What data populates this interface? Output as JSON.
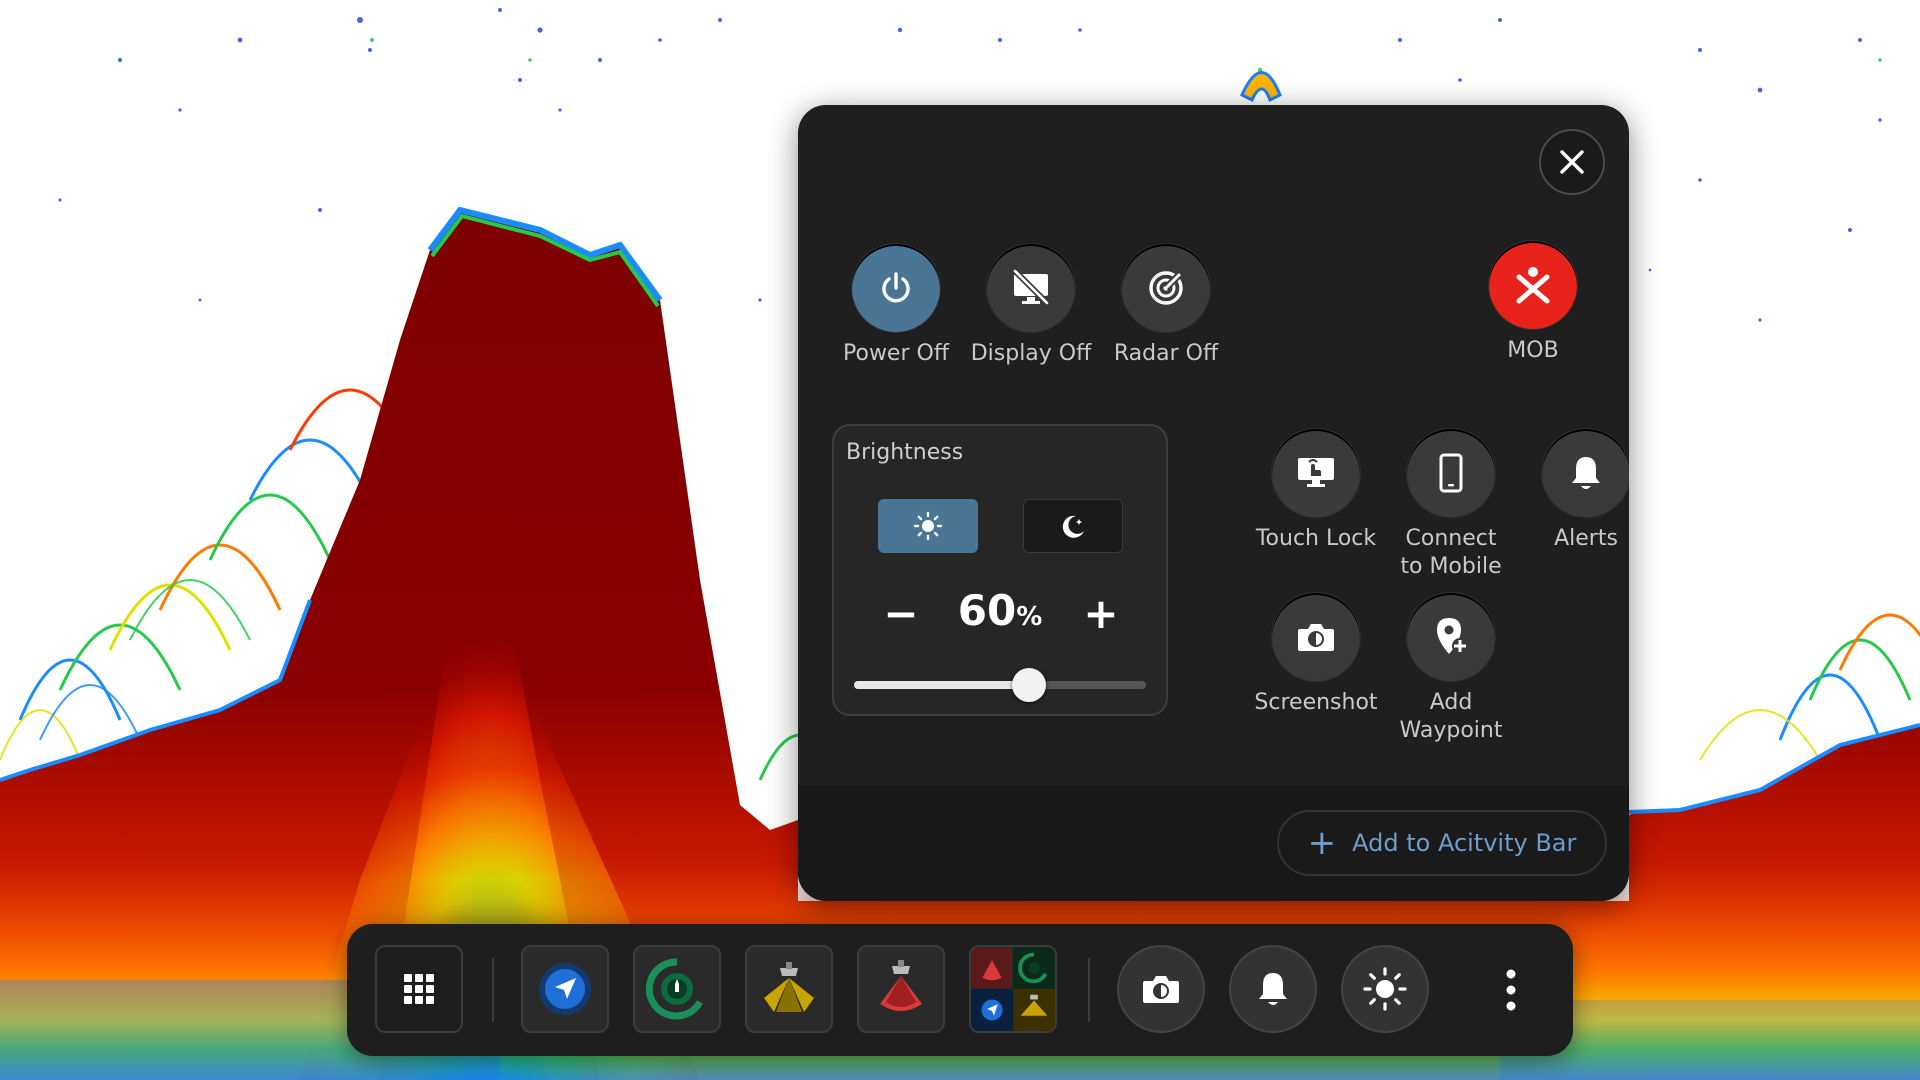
{
  "colors": {
    "accent_blue": "#4a7595",
    "mob_red": "#e7231c",
    "panel_bg": "#1f1f1f",
    "link_blue": "#6e9ccc",
    "sonar_deep_red": "#7a0000"
  },
  "panel": {
    "close_icon": "close-icon",
    "actions": [
      {
        "label": "Power Off",
        "icon": "power-icon"
      },
      {
        "label": "Display Off",
        "icon": "display-off-icon"
      },
      {
        "label": "Radar Off",
        "icon": "radar-off-icon"
      },
      {
        "label": "MOB",
        "icon": "man-overboard-icon"
      }
    ],
    "brightness": {
      "title": "Brightness",
      "day_icon": "sun-icon",
      "night_icon": "moon-icon",
      "minus": "−",
      "plus": "+",
      "value": "60",
      "unit": "%",
      "level": 0.6
    },
    "grid_actions": [
      {
        "label": "Touch Lock",
        "icon": "touch-lock-icon"
      },
      {
        "label": "Connect to Mobile",
        "label_line1": "Connect",
        "label_line2": "to Mobile",
        "icon": "mobile-icon"
      },
      {
        "label": "Alerts",
        "icon": "bell-icon"
      },
      {
        "label": "Screenshot",
        "icon": "camera-icon"
      },
      {
        "label": "Add Waypoint",
        "label_line1": "Add",
        "label_line2": "Waypoint",
        "icon": "add-waypoint-icon"
      }
    ],
    "add_activity": "Add to Acitvity Bar"
  },
  "activity_bar": {
    "items": [
      {
        "icon": "apps-grid-icon"
      },
      {
        "icon": "navigation-chart-icon"
      },
      {
        "icon": "radar-app-icon"
      },
      {
        "icon": "sidescan-sonar-icon"
      },
      {
        "icon": "fishfinder-sonar-icon"
      },
      {
        "icon": "split-view-icon"
      },
      {
        "icon": "camera-icon"
      },
      {
        "icon": "bell-icon"
      },
      {
        "icon": "brightness-icon"
      },
      {
        "icon": "more-vertical-icon"
      }
    ]
  }
}
